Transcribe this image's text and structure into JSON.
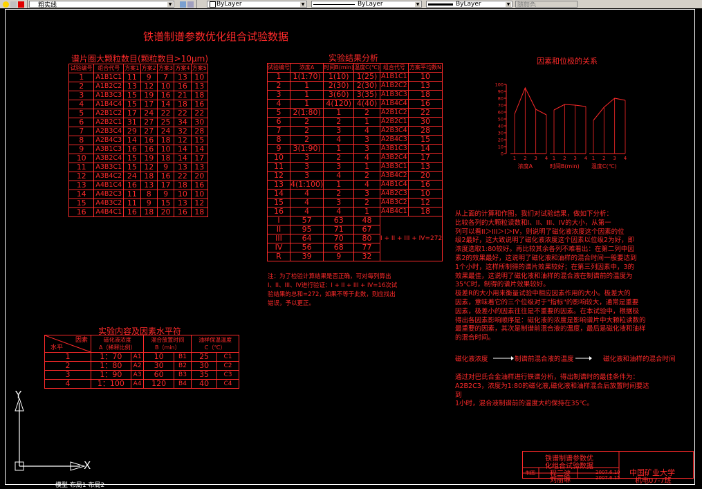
{
  "toolbar": {
    "linetype_value": "粗实线",
    "layer_value": "ByLayer",
    "linetype2_value": "ByLayer",
    "lineweight_value": "ByLayer",
    "plotstyle_value": "随颜色"
  },
  "drawing": {
    "main_title": "铁谱制谱参数优化组合试验数据",
    "table1": {
      "title": "谱片圈大颗粒数目(颗粒数目>10μm)",
      "headers": [
        "试验编号",
        "组合代号",
        "方案1",
        "方案2",
        "方案3",
        "方案4",
        "方案5"
      ],
      "rows": [
        [
          "1",
          "A1B1C1",
          "11",
          "9",
          "7",
          "13",
          "10"
        ],
        [
          "2",
          "A1B2C2",
          "13",
          "12",
          "10",
          "16",
          "13"
        ],
        [
          "3",
          "A1B3C3",
          "15",
          "19",
          "16",
          "21",
          "18"
        ],
        [
          "4",
          "A1B4C4",
          "15",
          "17",
          "14",
          "18",
          "16"
        ],
        [
          "5",
          "A2B1C2",
          "17",
          "24",
          "22",
          "22",
          "22"
        ],
        [
          "6",
          "A2B2C1",
          "31",
          "27",
          "25",
          "34",
          "30"
        ],
        [
          "7",
          "A2B3C4",
          "29",
          "27",
          "24",
          "32",
          "28"
        ],
        [
          "8",
          "A2B4C3",
          "14",
          "16",
          "18",
          "12",
          "15"
        ],
        [
          "9",
          "A3B1C3",
          "16",
          "16",
          "10",
          "14",
          "14"
        ],
        [
          "10",
          "A3B2C4",
          "15",
          "19",
          "18",
          "14",
          "17"
        ],
        [
          "11",
          "A3B3C1",
          "15",
          "12",
          "9",
          "13",
          "13"
        ],
        [
          "12",
          "A3B4C2",
          "24",
          "18",
          "16",
          "22",
          "20"
        ],
        [
          "13",
          "A4B1C4",
          "16",
          "13",
          "17",
          "18",
          "16"
        ],
        [
          "14",
          "A4B2C3",
          "11",
          "8",
          "9",
          "10",
          "10"
        ],
        [
          "15",
          "A4B3C2",
          "11",
          "9",
          "15",
          "13",
          "12"
        ],
        [
          "16",
          "A4B4C1",
          "16",
          "18",
          "20",
          "16",
          "18"
        ]
      ]
    },
    "table2": {
      "title": "实验结果分析",
      "headers": [
        "试验编号",
        "浓度A",
        "时间B(min)",
        "温度C(℃)",
        "组合代号",
        "方案平均数N"
      ],
      "rows": [
        [
          "1",
          "1(1:70)",
          "1(10)",
          "1(25)",
          "A1B1C1",
          "10"
        ],
        [
          "2",
          "1",
          "2(30)",
          "2(30)",
          "A1B2C2",
          "13"
        ],
        [
          "3",
          "1",
          "3(60)",
          "3(35)",
          "A1B3C3",
          "18"
        ],
        [
          "4",
          "1",
          "4(120)",
          "4(40)",
          "A1B4C4",
          "16"
        ],
        [
          "5",
          "2(1:80)",
          "1",
          "2",
          "A2B1C2",
          "22"
        ],
        [
          "6",
          "2",
          "2",
          "1",
          "A2B2C1",
          "30"
        ],
        [
          "7",
          "2",
          "3",
          "4",
          "A2B3C4",
          "28"
        ],
        [
          "8",
          "2",
          "4",
          "3",
          "A2B4C3",
          "15"
        ],
        [
          "9",
          "3(1:90)",
          "1",
          "3",
          "A3B1C3",
          "14"
        ],
        [
          "10",
          "3",
          "2",
          "4",
          "A3B2C4",
          "17"
        ],
        [
          "11",
          "3",
          "3",
          "1",
          "A3B3C1",
          "13"
        ],
        [
          "12",
          "3",
          "4",
          "2",
          "A3B4C2",
          "20"
        ],
        [
          "13",
          "4(1:100)",
          "1",
          "4",
          "A4B1C4",
          "16"
        ],
        [
          "14",
          "4",
          "2",
          "3",
          "A4B2C3",
          "10"
        ],
        [
          "15",
          "4",
          "3",
          "2",
          "A4B3C2",
          "12"
        ],
        [
          "16",
          "4",
          "4",
          "1",
          "A4B4C1",
          "18"
        ]
      ],
      "sum_rows": [
        [
          "I",
          "57",
          "63",
          "48"
        ],
        [
          "II",
          "95",
          "71",
          "67"
        ],
        [
          "III",
          "64",
          "70",
          "80"
        ],
        [
          "IV",
          "56",
          "68",
          "77"
        ],
        [
          "R",
          "39",
          "9",
          "32"
        ]
      ],
      "sum_formula": "I + II + III + IV=272",
      "note": [
        "注：为了检验计算结果是否正确，可对每列算出",
        "I、II、III、IV进行验证：I + II + III + IV=16次试",
        "验结果的总和=272，如果不等于此数，则应找出",
        "错误，予以更正。"
      ]
    },
    "table3": {
      "title": "实验内容及因素水平符",
      "corner_top": "因素",
      "corner_bottom": "水平",
      "headers": [
        "磁化液浓度\nA（稀释比例）",
        "混合放置时间\nB（min）",
        "油样保温温度\nC（℃）"
      ],
      "rows": [
        [
          "1",
          "1：70",
          "A1",
          "10",
          "B1",
          "25",
          "C1"
        ],
        [
          "2",
          "1：80",
          "A2",
          "30",
          "B2",
          "30",
          "C2"
        ],
        [
          "3",
          "1：90",
          "A3",
          "60",
          "B3",
          "35",
          "C3"
        ],
        [
          "4",
          "1：100",
          "A4",
          "120",
          "B4",
          "40",
          "C4"
        ]
      ]
    },
    "chart_title": "因素和位极的关系",
    "chart_data": {
      "type": "line",
      "title": "因素和位极的关系",
      "ylim": [
        0,
        100
      ],
      "yticks": [
        0,
        10,
        20,
        30,
        40,
        50,
        60,
        70,
        80,
        90,
        100
      ],
      "groups": [
        {
          "label": "浓度A",
          "x": [
            "1",
            "2",
            "3",
            "4"
          ],
          "values": [
            57,
            95,
            64,
            56
          ]
        },
        {
          "label": "时间B(min)",
          "x": [
            "1",
            "2",
            "3",
            "4"
          ],
          "values": [
            63,
            71,
            70,
            68
          ]
        },
        {
          "label": "温度C(℃)",
          "x": [
            "1",
            "2",
            "3",
            "4"
          ],
          "values": [
            48,
            67,
            80,
            77
          ]
        }
      ]
    },
    "analysis": [
      "    从上面的计算和作图，我们对试验结果，做如下分析：",
      "    比较各列的大颗粒读数和I、II、III、IV的大小，从第一",
      "列可以看II＞III＞I＞IV，则说明了磁化液浓度这个因素的位",
      "级2最好，这大致说明了磁化液浓度这个因素以位级2为好，即",
      "浓度选取1:80较好。再比较其余各列不难看出：在第二列中因",
      "素2的效果最好，这说明了磁化液和油样的混合时间一般要达到",
      "1个小时，这样所制得的谱片效果较好；在第三列因素中，3的",
      "效果最佳，这说明了磁化液和油样的混合液在制谱前的温度为",
      "35℃时，制得的谱片效果较好。",
      "    极差R的大小用来衡量试验中相应因素作用的大小。极差大的",
      "因素，意味着它的三个位级对于\"指标\"的影响较大，通常是重要",
      "因素，极差小的因素往往是不重要的因素。在本试验中，根据极",
      "得出各因素影响顺序是：磁化液的浓度是影响谱片中大颗粒读数的",
      "最重要的因素，其次是制谱前混合液的温度，最后是磁化液和油样",
      "的混合时间。"
    ],
    "flow": {
      "a": "磁化液浓度",
      "b": "制谱前混合液的温度",
      "c": "磁化液和油样的混合时间"
    },
    "conclusion": [
      "    通过对巴氏合金油样进行铁谱分析，得出制谱时的最佳条件为：",
      "A2B2C3，浓度为1:80的磁化液,磁化液和油样混合后放置时间要达",
      "到",
      "1小时，混合液制谱前的温度大约保持在35℃。"
    ],
    "titleblock": {
      "title_line1": "铁谱制谱参数优",
      "title_line2": "化组合试验数据",
      "school": "中国矿业大学",
      "row1_role": "制图",
      "row1_name": "程三波",
      "row1_date": "2007.6.10",
      "row2_name": "刘丽琳",
      "row2_date": "2007.6.15",
      "class": "机电07-7班"
    },
    "ucs": {
      "x": "X",
      "y": "Y"
    },
    "tabs": "模型 布局1 布局2"
  }
}
